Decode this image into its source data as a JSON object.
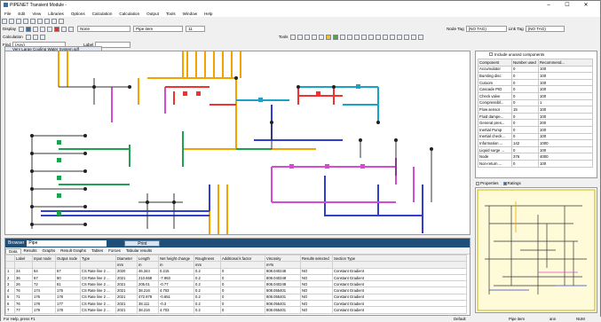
{
  "window": {
    "title": "PIPENET Transient Module -",
    "min": "–",
    "max": "☐",
    "close": "✕"
  },
  "menu": [
    "File",
    "Edit",
    "View",
    "Libraries",
    "Options",
    "Calculation",
    "Calculation",
    "Output",
    "Tools",
    "Window",
    "Help"
  ],
  "toolbar": {
    "display_label": "Display",
    "display_value": "11",
    "calc_label": "Calculation",
    "none_value": "None",
    "pipe_item": "Pipe item",
    "find_label": "Find",
    "find_value": "(Any)",
    "label_label": "Label",
    "node_tag_label": "Node Tag",
    "node_tag_value": "(NO TAG)",
    "link_tag_label": "Link Tag",
    "link_tag_value": "(NO TAG)",
    "tools_label": "Tools"
  },
  "canvas_tab": "Very Large Cooling Water System.sdf",
  "components": {
    "include_unused": "Include unused components",
    "headers": [
      "Component",
      "Number used",
      "Recommend..."
    ],
    "rows": [
      [
        "Accumulator",
        "0",
        "100"
      ],
      [
        "Bursting disc",
        "0",
        "100"
      ],
      [
        "Cutoom",
        "0",
        "100"
      ],
      [
        "Cascade PID",
        "0",
        "100"
      ],
      [
        "Check valve",
        "0",
        "100"
      ],
      [
        "Compressibl...",
        "0",
        "1"
      ],
      [
        "Flow sensor",
        "15",
        "100"
      ],
      [
        "Fluid dampe...",
        "0",
        "100"
      ],
      [
        "General pres...",
        "0",
        "200"
      ],
      [
        "Inertial Pump",
        "0",
        "100"
      ],
      [
        "Inertial check...",
        "0",
        "100"
      ],
      [
        "Information ...",
        "142",
        "1000"
      ],
      [
        "Liquid surge ...",
        "0",
        "100"
      ],
      [
        "Node",
        "376",
        "4000"
      ],
      [
        "Non-return ...",
        "0",
        "100"
      ]
    ],
    "tab_properties": "Properties",
    "tab_ratings": "Ratings"
  },
  "browser": {
    "label": "Browser",
    "item": "Pipe",
    "print": "Print",
    "tabs": [
      "Data",
      "Results",
      "Graphs",
      "Result Graphs",
      "Tables",
      "Forces",
      "Tabular results"
    ],
    "headers": [
      "Label",
      "Input node",
      "Output node",
      "Type",
      "Diameter",
      "Length",
      "Net height change",
      "Roughness",
      "Additional k factor",
      "Viscosity",
      "Results selected",
      "Section Type"
    ],
    "units": [
      "",
      "",
      "",
      "",
      "mm",
      "m",
      "m",
      "mm",
      "",
      "m²/s",
      "",
      ""
    ],
    "rows": [
      [
        "1",
        "34",
        "64",
        "67",
        "CS Rate line 2 ...",
        "2020",
        "46.344",
        "0.215",
        "0.2",
        "0",
        "808.040248",
        "NO",
        "Constant Gradient"
      ],
      [
        "2",
        "36",
        "67",
        "80",
        "CS Rate line 2 ...",
        "2021",
        "210.658",
        "-7.963",
        "0.2",
        "0",
        "808.040248",
        "NO",
        "Constant Gradient"
      ],
      [
        "3",
        "26",
        "72",
        "81",
        "CS Rate line 2 ...",
        "2021",
        "205.01",
        "-0.77",
        "0.2",
        "0",
        "808.040248",
        "NO",
        "Constant Gradient"
      ],
      [
        "4",
        "76",
        "174",
        "175",
        "CS Rate line 2 ...",
        "2021",
        "38.216",
        "4.703",
        "0.2",
        "0",
        "808.055401",
        "NO",
        "Constant Gradient"
      ],
      [
        "5",
        "71",
        "176",
        "178",
        "CS Rate line 2 ...",
        "2021",
        "472.978",
        "-0.651",
        "0.2",
        "0",
        "808.055401",
        "NO",
        "Constant Gradient"
      ],
      [
        "6",
        "76",
        "178",
        "177",
        "CS Rate line 2 ...",
        "2021",
        "38.111",
        "-0.3",
        "0.2",
        "0",
        "808.055401",
        "NO",
        "Constant Gradient"
      ],
      [
        "7",
        "77",
        "179",
        "178",
        "CS Rate line 2 ...",
        "2021",
        "38.216",
        "4.703",
        "0.2",
        "0",
        "808.055401",
        "NO",
        "Constant Gradient"
      ]
    ]
  },
  "status": {
    "help": "For Help, press F1",
    "mode": "Default",
    "pos": "Pipe item",
    "num": "NUM",
    "caps": "ann"
  }
}
